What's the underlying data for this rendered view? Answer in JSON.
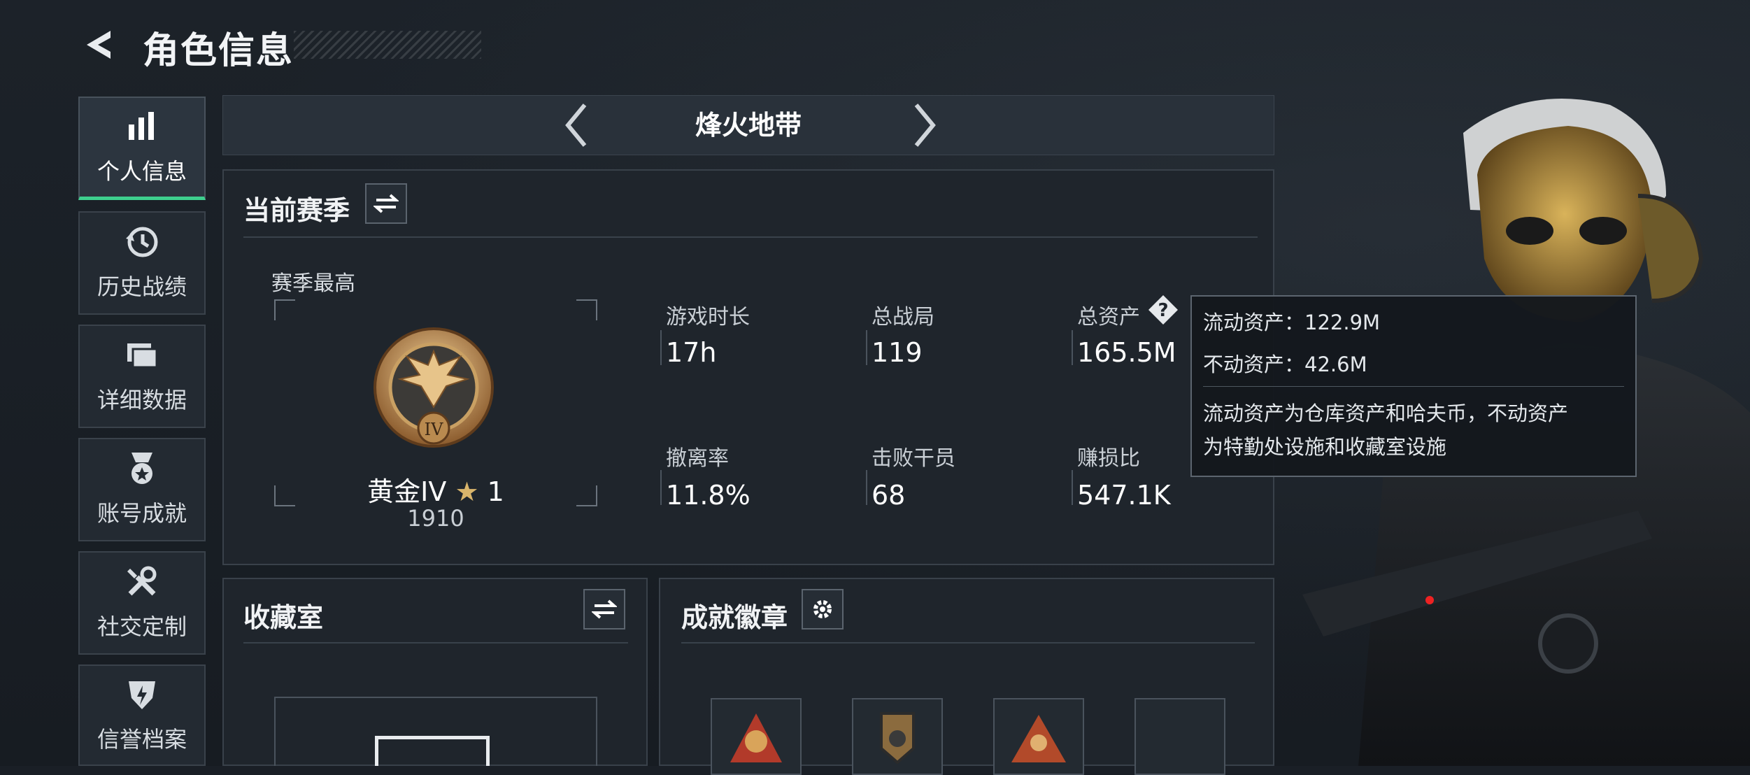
{
  "header": {
    "title": "角色信息"
  },
  "sidebar": {
    "items": [
      {
        "label": "个人信息",
        "icon": "bar-chart-icon",
        "active": true
      },
      {
        "label": "历史战绩",
        "icon": "history-clock-icon"
      },
      {
        "label": "详细数据",
        "icon": "folder-icon"
      },
      {
        "label": "账号成就",
        "icon": "medal-icon"
      },
      {
        "label": "社交定制",
        "icon": "tools-icon"
      },
      {
        "label": "信誉档案",
        "icon": "shield-icon"
      }
    ]
  },
  "game_tab": {
    "title": "烽火地带"
  },
  "season_panel": {
    "title": "当前赛季",
    "season_high_label": "赛季最高",
    "rank": {
      "name": "黄金IV",
      "stars": "1",
      "score": "1910",
      "emblem_numeral": "IV"
    },
    "stats": [
      {
        "label": "游戏时长",
        "value": "17h"
      },
      {
        "label": "总战局",
        "value": "119"
      },
      {
        "label": "总资产",
        "value": "165.5M"
      },
      {
        "label": "撤离率",
        "value": "11.8%"
      },
      {
        "label": "击败干员",
        "value": "68"
      },
      {
        "label": "赚损比",
        "value": "547.1K"
      }
    ]
  },
  "tooltip": {
    "liquid": "流动资产：122.9M",
    "fixed": "不动资产：42.6M",
    "desc_line1": "流动资产为仓库资产和哈夫币，不动资产",
    "desc_line2": "为特勤处设施和收藏室设施"
  },
  "collection_panel": {
    "title": "收藏室"
  },
  "badges_panel": {
    "title": "成就徽章"
  },
  "colors": {
    "accent": "#3ecf8e",
    "panel": "#1f252c",
    "gold": "#c9a063"
  }
}
